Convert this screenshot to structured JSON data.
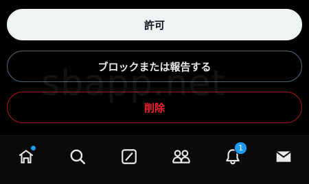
{
  "actions": {
    "allow_label": "許可",
    "block_report_label": "ブロックまたは報告する",
    "delete_label": "削除"
  },
  "watermark": "sbapp.net",
  "nav": {
    "items": [
      {
        "name": "home",
        "icon": "home-icon",
        "has_dot": true
      },
      {
        "name": "search",
        "icon": "search-icon"
      },
      {
        "name": "compose",
        "icon": "compose-icon"
      },
      {
        "name": "communities",
        "icon": "communities-icon"
      },
      {
        "name": "notifications",
        "icon": "bell-icon",
        "badge": "1"
      },
      {
        "name": "messages",
        "icon": "mail-icon"
      }
    ],
    "notification_badge": "1"
  },
  "colors": {
    "background": "#000000",
    "allow_bg": "#eff3f4",
    "delete_text": "#f4212e",
    "accent": "#1d9bf0"
  }
}
